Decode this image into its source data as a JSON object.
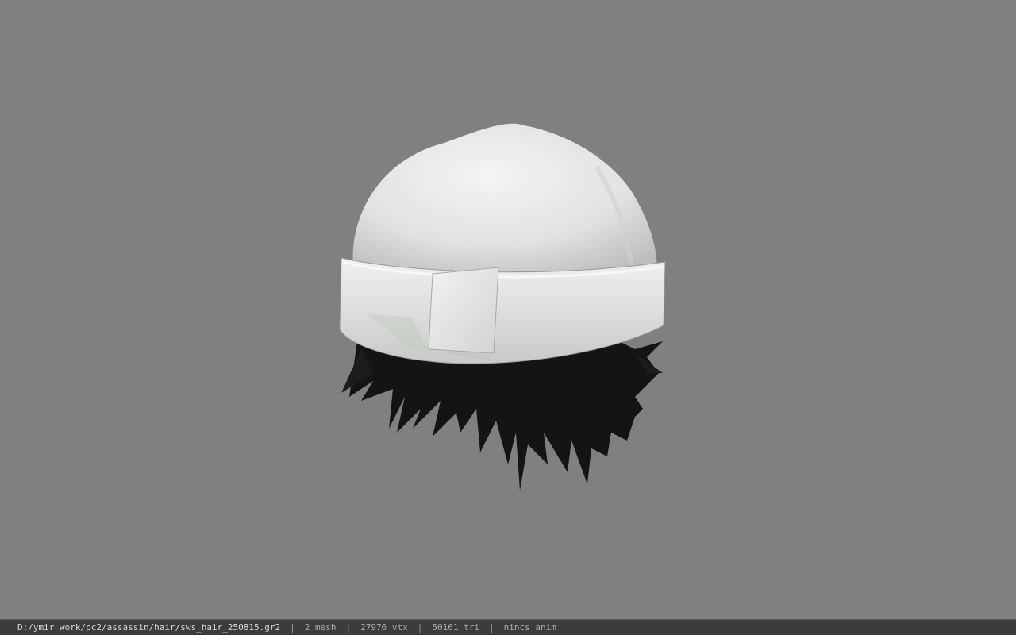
{
  "status_bar": {
    "file_path": "D:/ymir work/pc2/assassin/hair/sws_hair_250815.gr2",
    "separator": "|",
    "mesh_count": "2 mesh",
    "vertex_count": "27976 vtx",
    "triangle_count": "50161 tri",
    "anim_info": "nincs anim"
  },
  "viewport": {
    "background_color": "#808080",
    "model": "hair mesh with cap"
  }
}
